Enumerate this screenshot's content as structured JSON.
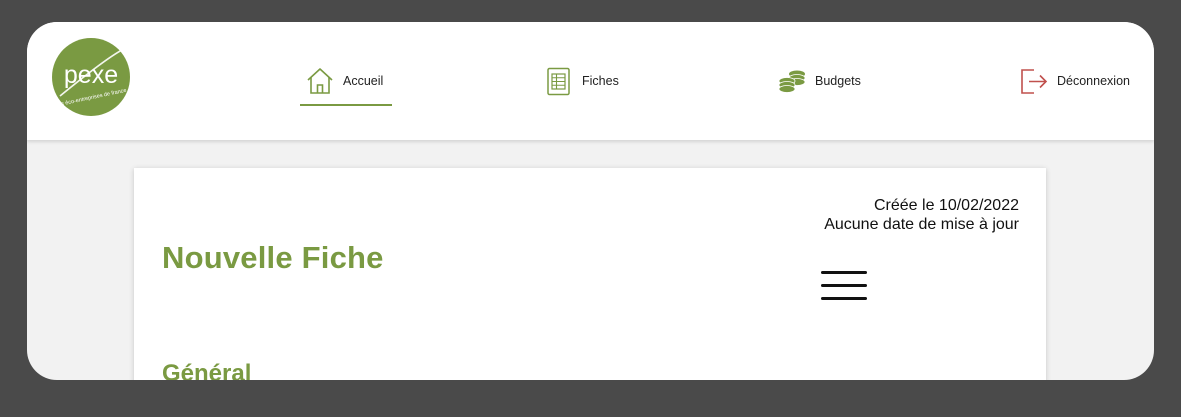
{
  "brand": {
    "logo_text": "pexe",
    "logo_tagline": "les éco-entreprises de france",
    "primary_color": "#7a9a42",
    "logout_color": "#c0504d"
  },
  "nav": {
    "items": [
      {
        "label": "Accueil",
        "icon": "home-icon",
        "active": true
      },
      {
        "label": "Fiches",
        "icon": "spreadsheet-icon",
        "active": false
      },
      {
        "label": "Budgets",
        "icon": "coins-icon",
        "active": false
      },
      {
        "label": "Déconnexion",
        "icon": "logout-icon",
        "active": false
      }
    ]
  },
  "card": {
    "created": "Créée le 10/02/2022",
    "updated": "Aucune date de mise à jour",
    "title": "Nouvelle Fiche",
    "menu_icon": "hamburger-menu-icon",
    "section_title": "Général"
  }
}
